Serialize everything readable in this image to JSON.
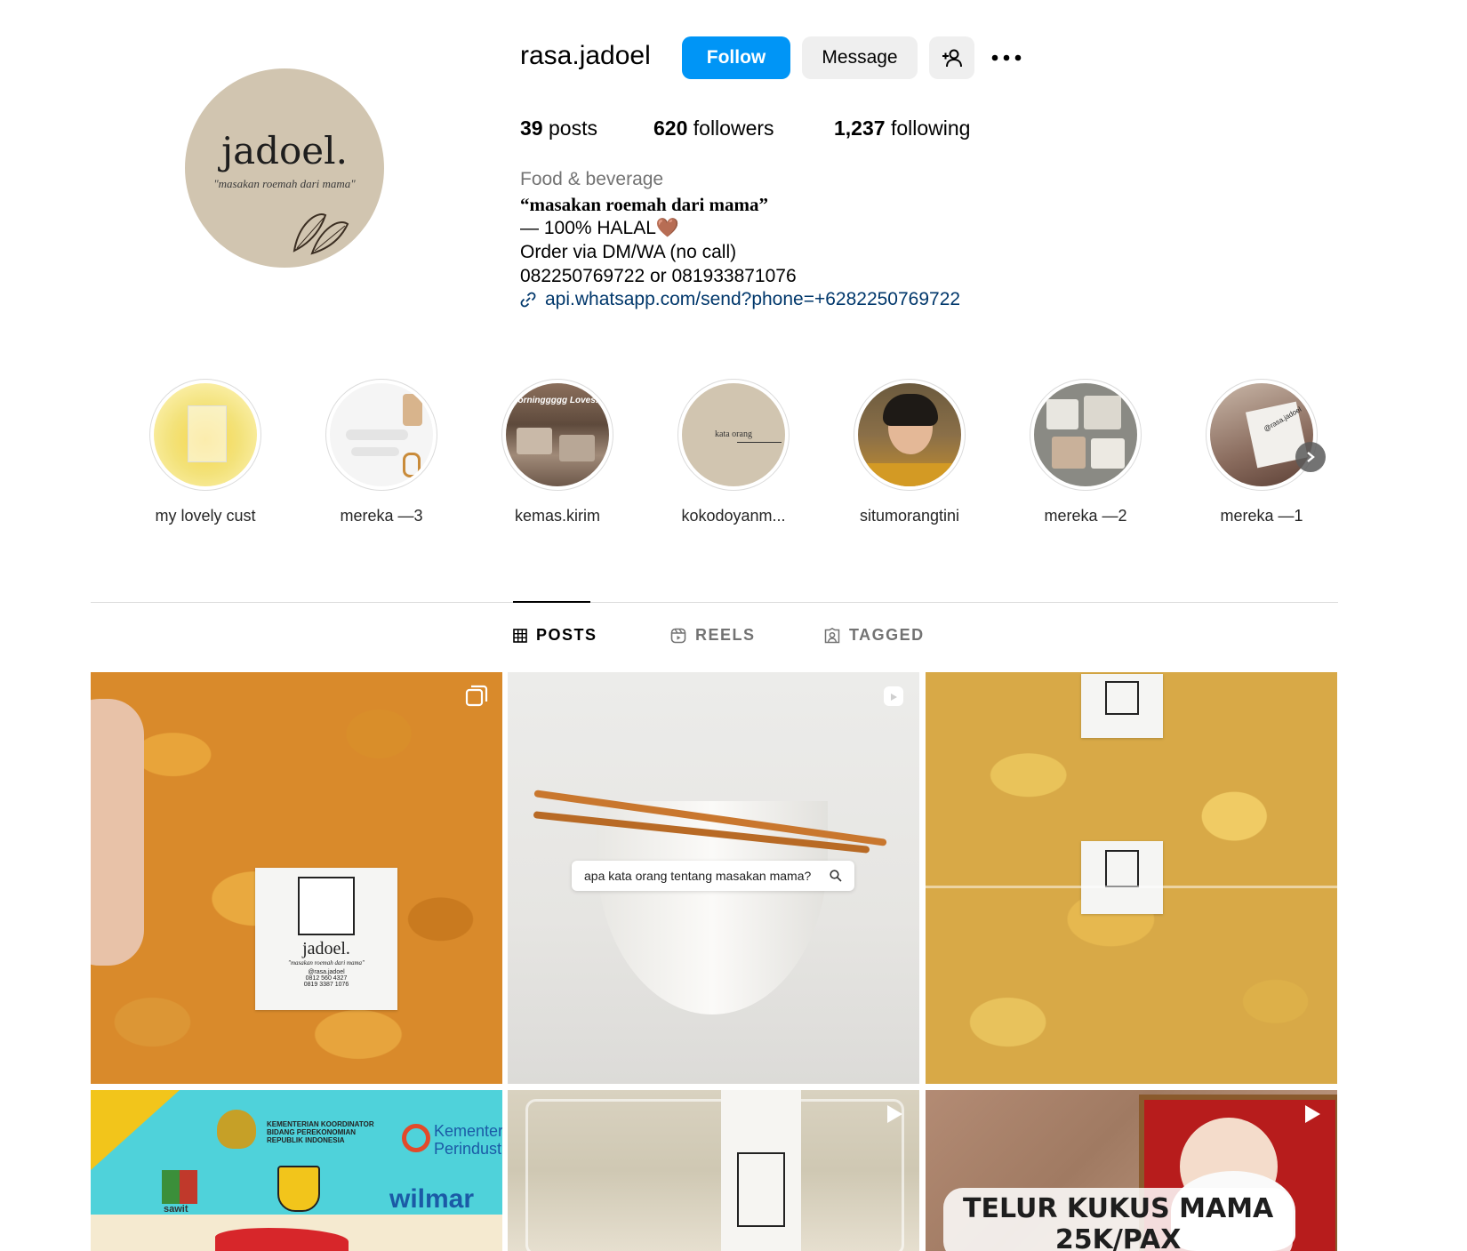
{
  "profile": {
    "username": "rasa.jadoel",
    "avatar_title": "jadoel.",
    "avatar_subtitle": "\"masakan roemah dari mama\"",
    "follow_label": "Follow",
    "message_label": "Message",
    "add_user_icon": "person-plus-icon",
    "more_icon": "ellipsis-icon"
  },
  "stats": {
    "posts_count": "39",
    "posts_label": "posts",
    "followers_count": "620",
    "followers_label": "followers",
    "following_count": "1,237",
    "following_label": "following"
  },
  "bio": {
    "category": "Food & beverage",
    "line1": "“masakan roemah dari mama”",
    "line2": "— 100% HALAL🤎",
    "line3": "Order via DM/WA (no call)",
    "line4": "082250769722 or 081933871076",
    "link": "api.whatsapp.com/send?phone=+6282250769722"
  },
  "highlights": [
    {
      "label": "my lovely cust"
    },
    {
      "label": "mereka —3"
    },
    {
      "label": "kemas.kirim"
    },
    {
      "label": "kokodoyanm..."
    },
    {
      "label": "situmorangtini"
    },
    {
      "label": "mereka —2"
    },
    {
      "label": "mereka —1"
    }
  ],
  "highlight_inner_text": {
    "kata_orang": "kata orang",
    "morning": "Morninggggg Loves!!!",
    "handle": "@rasa.jadoel"
  },
  "tabs": [
    {
      "label": "POSTS",
      "icon": "grid-icon",
      "active": true
    },
    {
      "label": "REELS",
      "icon": "reels-icon",
      "active": false
    },
    {
      "label": "TAGGED",
      "icon": "tagged-icon",
      "active": false
    }
  ],
  "posts": {
    "p1_label_title": "jadoel.",
    "p1_label_sub": "\"masakan roemah dari mama\"",
    "p1_label_handle": "@rasa.jadoel",
    "p1_label_phone1": "0812 560 4327",
    "p1_label_phone2": "0819 3387 1076",
    "p2_search_text": "apa kata orang tentang masakan mama?",
    "p4_banner_line1": "KEMENTERIAN KOORDINATOR",
    "p4_banner_line2": "BIDANG PEREKONOMIAN",
    "p4_banner_line3": "REPUBLIK INDONESIA",
    "p4_kemen": "Kementer",
    "p4_perind": "Perindust",
    "p4_sawit": "sawit",
    "p4_wilmar": "wilmar",
    "p6_caption1": "TELUR KUKUS MAMA",
    "p6_caption2": "25K/PAX"
  },
  "colors": {
    "follow_button": "#0095f6",
    "link": "#00376b",
    "secondary_text": "#737373",
    "avatar_bg": "#d1c5b0"
  }
}
